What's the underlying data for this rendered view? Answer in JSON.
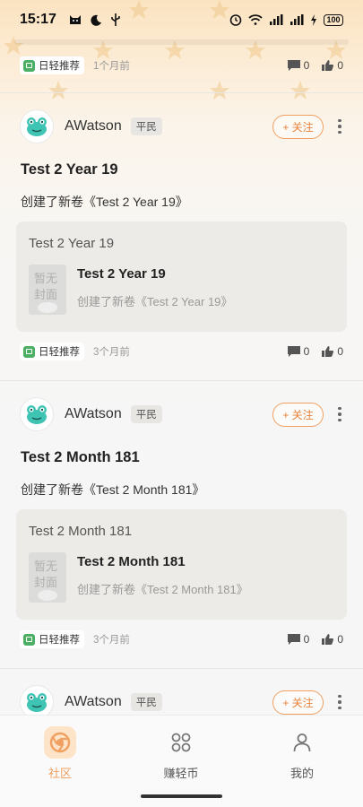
{
  "status_bar": {
    "time": "15:17",
    "battery": "100"
  },
  "top_meta": {
    "tag": "日轻推荐",
    "time": "1个月前",
    "comments": "0",
    "likes": "0"
  },
  "posts": [
    {
      "author": "AWatson",
      "rank": "平民",
      "follow_label": "+ 关注",
      "title": "Test 2 Year 19",
      "description": "创建了新卷《Test 2 Year 19》",
      "embed": {
        "heading": "Test 2 Year 19",
        "name": "Test 2 Year 19",
        "subtitle": "创建了新卷《Test 2 Year 19》",
        "cover_text": "暂无封面"
      },
      "tag": "日轻推荐",
      "time": "3个月前",
      "comments": "0",
      "likes": "0"
    },
    {
      "author": "AWatson",
      "rank": "平民",
      "follow_label": "+ 关注",
      "title": "Test 2 Month 181",
      "description": "创建了新卷《Test 2 Month 181》",
      "embed": {
        "heading": "Test 2 Month 181",
        "name": "Test 2 Month 181",
        "subtitle": "创建了新卷《Test 2 Month 181》",
        "cover_text": "暂无封面"
      },
      "tag": "日轻推荐",
      "time": "3个月前",
      "comments": "0",
      "likes": "0"
    },
    {
      "author": "AWatson",
      "rank": "平民",
      "follow_label": "+ 关注"
    }
  ],
  "bottom_nav": [
    {
      "label": "社区",
      "icon": "community-icon",
      "active": true
    },
    {
      "label": "赚轻币",
      "icon": "grid-icon",
      "active": false
    },
    {
      "label": "我的",
      "icon": "profile-icon",
      "active": false
    }
  ],
  "colors": {
    "accent": "#f0a060",
    "tag_green": "#4caf64",
    "embed_bg": "#ecebe7"
  }
}
